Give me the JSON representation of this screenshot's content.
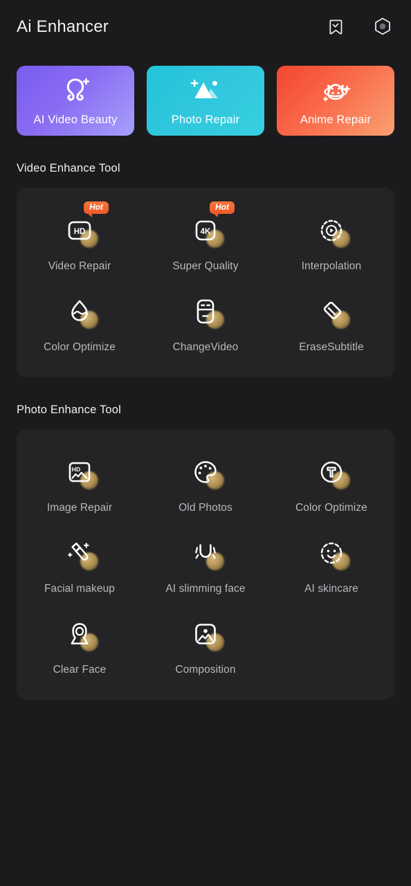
{
  "header": {
    "title": "Ai Enhancer",
    "bookmark_icon": "bookmark-check-icon",
    "settings_icon": "hexagon-settings-icon"
  },
  "features": [
    {
      "label": "AI Video Beauty",
      "icon": "hair-beauty-icon",
      "color": "#8a6cf3"
    },
    {
      "label": "Photo Repair",
      "icon": "mountain-photo-icon",
      "color": "#2fc6dd"
    },
    {
      "label": "Anime Repair",
      "icon": "anime-cat-icon",
      "color": "#f96a4a"
    }
  ],
  "sections": [
    {
      "title": "Video Enhance Tool",
      "items": [
        {
          "label": "Video Repair",
          "icon": "hd-badge-icon",
          "badge": "Hot"
        },
        {
          "label": "Super Quality",
          "icon": "4k-badge-icon",
          "badge": "Hot"
        },
        {
          "label": "Interpolation",
          "icon": "dashed-play-icon",
          "badge": ""
        },
        {
          "label": "Color Optimize",
          "icon": "droplet-wave-icon",
          "badge": ""
        },
        {
          "label": "ChangeVideo",
          "icon": "video-panel-icon",
          "badge": ""
        },
        {
          "label": "EraseSubtitle",
          "icon": "eraser-icon",
          "badge": ""
        }
      ]
    },
    {
      "title": "Photo Enhance Tool",
      "items": [
        {
          "label": "Image Repair",
          "icon": "hd-photo-frame-icon",
          "badge": ""
        },
        {
          "label": "Old Photos",
          "icon": "palette-icon",
          "badge": ""
        },
        {
          "label": "Color Optimize",
          "icon": "color-picker-icon",
          "badge": ""
        },
        {
          "label": "Facial makeup",
          "icon": "lipstick-sparkle-icon",
          "badge": ""
        },
        {
          "label": "AI slimming face",
          "icon": "face-slim-arc-icon",
          "badge": ""
        },
        {
          "label": "AI skincare",
          "icon": "smiley-dashed-icon",
          "badge": ""
        },
        {
          "label": "Clear Face",
          "icon": "portrait-icon",
          "badge": ""
        },
        {
          "label": "Composition",
          "icon": "image-frame-icon",
          "badge": ""
        }
      ]
    }
  ],
  "theme": {
    "background": "#1b1b1d",
    "panel": "#242426",
    "label": "#b9b9bc",
    "accent_hot": "#ee5a2a",
    "accent_gold": "#c9a663"
  }
}
